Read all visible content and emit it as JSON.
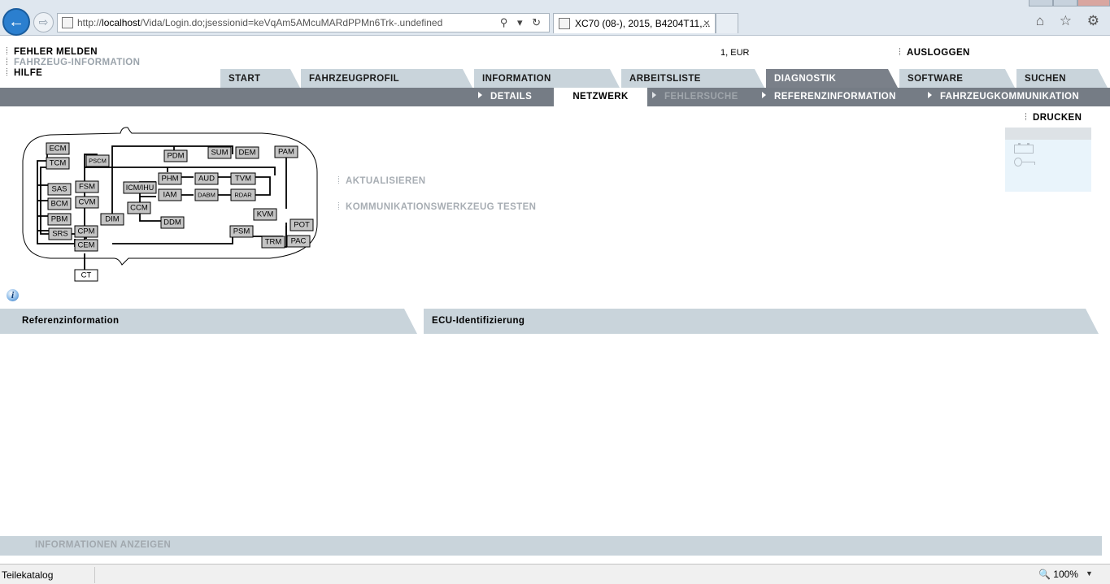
{
  "browser": {
    "url_prefix": "http://",
    "url_host": "localhost",
    "url_path": "/Vida/Login.do;jsessionid=keVqAm5AMcuMARdPPMn6Trk-.undefined",
    "tab_title": "XC70 (08-), 2015, B4204T11,...",
    "tab_close": "×",
    "addr_tools": "⚲ ▾ ↻",
    "right_tools": "⌂ ☆ ⚙",
    "back_glyph": "←",
    "fwd_glyph": "⇨"
  },
  "header": {
    "links": [
      "FEHLER MELDEN",
      "FAHRZEUG-INFORMATION",
      "HILFE"
    ],
    "currency": "1, EUR",
    "logout": "AUSLOGGEN"
  },
  "main_tabs": [
    "START",
    "FAHRZEUGPROFIL",
    "INFORMATION",
    "ARBEITSLISTE",
    "DIAGNOSTIK",
    "SOFTWARE",
    "SUCHEN"
  ],
  "active_main_tab": "DIAGNOSTIK",
  "sub_tabs": [
    "DETAILS",
    "NETZWERK",
    "FEHLERSUCHE",
    "REFERENZINFORMATION",
    "FAHRZEUGKOMMUNIKATION"
  ],
  "active_sub_tab": "NETZWERK",
  "disabled_sub_tab": "FEHLERSUCHE",
  "print_label": "DRUCKEN",
  "actions": [
    "AKTUALISIEREN",
    "KOMMUNIKATIONSWERKZEUG TESTEN"
  ],
  "network": {
    "modules": [
      "ECM",
      "TCM",
      "PSCM",
      "PDM",
      "SUM",
      "DEM",
      "PAM",
      "PHM",
      "AUD",
      "TVM",
      "ICM/IHU",
      "IAM",
      "DABM",
      "RDAR",
      "SAS",
      "FSM",
      "BCM",
      "CVM",
      "CCM",
      "DDM",
      "PBM",
      "DIM",
      "KVM",
      "POT",
      "SRS",
      "CPM",
      "PSM",
      "TRM",
      "PAC",
      "CEM",
      "CT"
    ]
  },
  "info_icon_glyph": "i",
  "panels": {
    "reference": "Referenzinformation",
    "ecu": "ECU-Identifizierung"
  },
  "info_bar": "INFORMATIONEN ANZEIGEN",
  "statusbar": {
    "text": "Teilekatalog",
    "zoom": "🔍 100%",
    "zoom_drop": "▼"
  }
}
